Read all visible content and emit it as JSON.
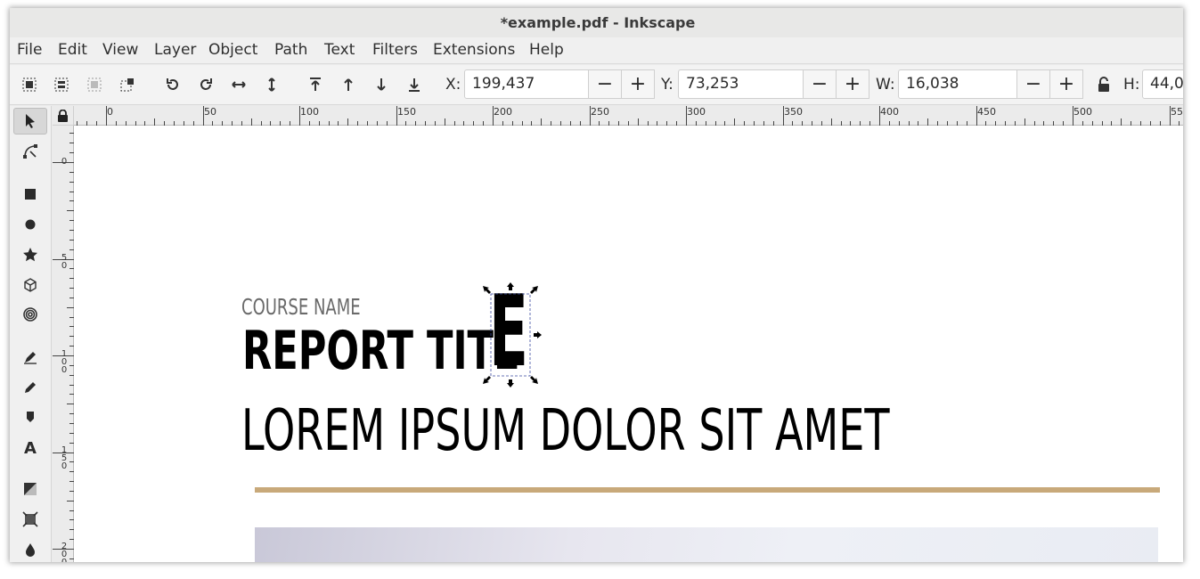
{
  "window": {
    "title": "*example.pdf - Inkscape"
  },
  "menubar": {
    "items": [
      "File",
      "Edit",
      "View",
      "Layer",
      "Object",
      "Path",
      "Text",
      "Filters",
      "Extensions",
      "Help"
    ]
  },
  "toolbar": {
    "icons": [
      "select-all-icon",
      "select-all-layers-icon",
      "deselect-icon",
      "select-same-icon",
      "rotate-ccw-icon",
      "rotate-cw-icon",
      "flip-horizontal-icon",
      "flip-vertical-icon",
      "raise-to-top-icon",
      "raise-icon",
      "lower-icon",
      "lower-to-bottom-icon"
    ],
    "x": {
      "label": "X:",
      "value": "199,437"
    },
    "y": {
      "label": "Y:",
      "value": "73,253"
    },
    "w": {
      "label": "W:",
      "value": "16,038"
    },
    "h": {
      "label": "H:",
      "value": "44,0"
    },
    "minus": "−",
    "plus": "+"
  },
  "toolbox": {
    "tools": [
      "selector-tool",
      "node-tool",
      "rectangle-tool",
      "ellipse-tool",
      "star-tool",
      "3d-box-tool",
      "spiral-tool",
      "pen-tool",
      "pencil-tool",
      "calligraphy-tool",
      "text-tool",
      "gradient-tool",
      "mesh-tool",
      "dropper-tool"
    ],
    "text_tool_glyph": "A",
    "active_tool": "selector-tool"
  },
  "rulers": {
    "horizontal_labels": [
      "0",
      "50",
      "100",
      "150",
      "200",
      "250",
      "300",
      "350",
      "400",
      "450",
      "500",
      "55"
    ],
    "vertical_labels": [
      "0",
      "50",
      "100",
      "150",
      "200"
    ]
  },
  "document": {
    "course_name": "COURSE NAME",
    "report_title": "REPORT TITL",
    "selected_letter": "E",
    "subtitle": "LOREM IPSUM DOLOR SIT AMET",
    "accent_color": "#c8a97a"
  }
}
